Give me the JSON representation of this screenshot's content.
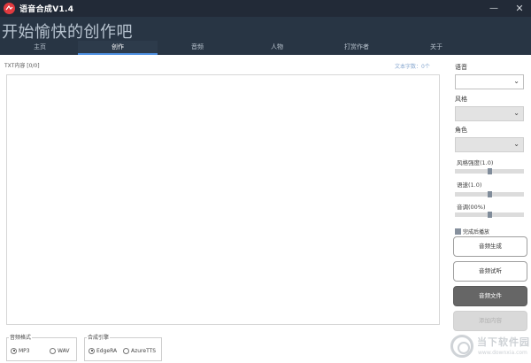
{
  "window": {
    "title": "语音合成V1.4",
    "minimize_glyph": "—",
    "close_glyph": "✕"
  },
  "banner": {
    "slogan": "开始愉快的创作吧"
  },
  "tabs": [
    {
      "label": "主页",
      "active": false
    },
    {
      "label": "创作",
      "active": true
    },
    {
      "label": "音频",
      "active": false
    },
    {
      "label": "人物",
      "active": false
    },
    {
      "label": "打赏作者",
      "active": false
    },
    {
      "label": "关于",
      "active": false
    }
  ],
  "editor": {
    "label": "TXT内容 [0/0]",
    "char_count": "文本字数：0个",
    "value": ""
  },
  "audio_format": {
    "title": "音频格式",
    "options": [
      {
        "label": "MP3",
        "checked": true
      },
      {
        "label": "WAV",
        "checked": false
      }
    ]
  },
  "engine": {
    "title": "合成引擎",
    "options": [
      {
        "label": "EdgeRA",
        "checked": true
      },
      {
        "label": "AzureTTS",
        "checked": false
      }
    ]
  },
  "settings": {
    "voice_label": "语音",
    "voice_value": "",
    "style_label": "风格",
    "style_value": "",
    "role_label": "角色",
    "role_value": "",
    "style_strength_label": "风格强度(1.0)",
    "style_strength_value": 0.5,
    "speed_label": "语速(1.0)",
    "speed_value": 0.5,
    "pitch_label": "音调(00%)",
    "pitch_value": 0.5,
    "chevron": "⌄"
  },
  "play_after_done": {
    "label": "完成后播放",
    "checked": true
  },
  "actions": {
    "generate": "音频生成",
    "preview": "音频试听",
    "file": "音频文件",
    "add_content": "添加内容"
  },
  "watermark": {
    "text": "当下软件园",
    "url": "www.downxia.com"
  },
  "colors": {
    "titlebar": "#222a37",
    "banner": "#283544",
    "tab_accent": "#4d8fe0",
    "app_icon": "#e23a3f"
  }
}
